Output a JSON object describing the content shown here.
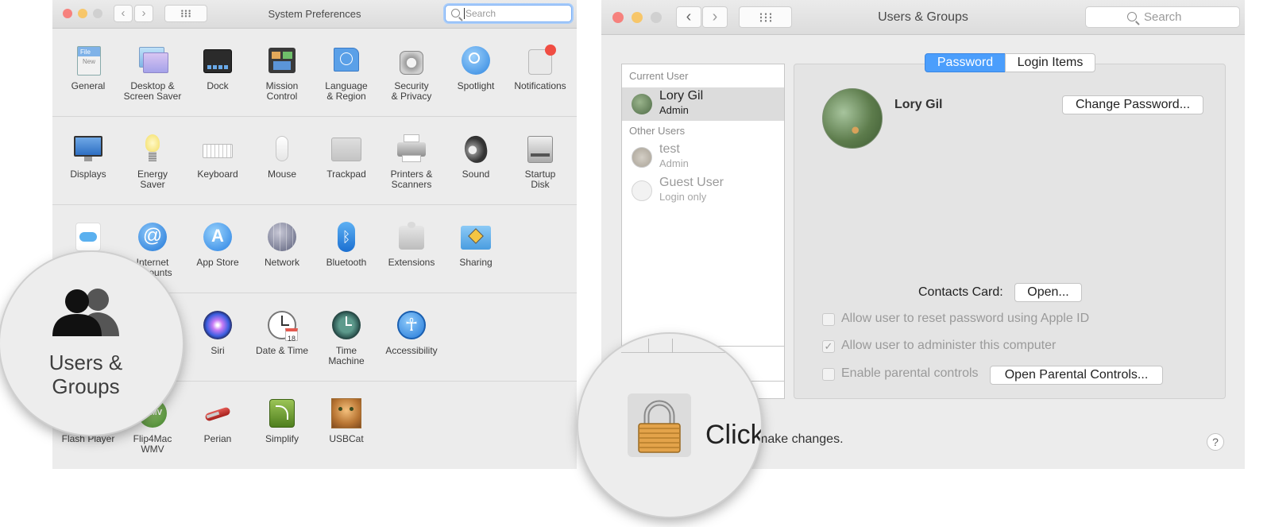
{
  "left_window": {
    "title": "System Preferences",
    "search_placeholder": "Search",
    "rows": [
      [
        {
          "label": "General",
          "icon": "general-icon"
        },
        {
          "label": "Desktop &\nScreen Saver",
          "icon": "desktop-screensaver-icon"
        },
        {
          "label": "Dock",
          "icon": "dock-icon"
        },
        {
          "label": "Mission\nControl",
          "icon": "mission-control-icon"
        },
        {
          "label": "Language\n& Region",
          "icon": "language-region-icon"
        },
        {
          "label": "Security\n& Privacy",
          "icon": "security-privacy-icon"
        },
        {
          "label": "Spotlight",
          "icon": "spotlight-icon"
        },
        {
          "label": "Notifications",
          "icon": "notifications-icon"
        }
      ],
      [
        {
          "label": "Displays",
          "icon": "displays-icon"
        },
        {
          "label": "Energy\nSaver",
          "icon": "energy-saver-icon"
        },
        {
          "label": "Keyboard",
          "icon": "keyboard-icon"
        },
        {
          "label": "Mouse",
          "icon": "mouse-icon"
        },
        {
          "label": "Trackpad",
          "icon": "trackpad-icon"
        },
        {
          "label": "Printers &\nScanners",
          "icon": "printers-scanners-icon"
        },
        {
          "label": "Sound",
          "icon": "sound-icon"
        },
        {
          "label": "Startup\nDisk",
          "icon": "startup-disk-icon"
        }
      ],
      [
        {
          "label": "",
          "icon": "icloud-icon"
        },
        {
          "label": "Internet\nAccounts",
          "icon": "internet-accounts-icon"
        },
        {
          "label": "App Store",
          "icon": "app-store-icon"
        },
        {
          "label": "Network",
          "icon": "network-icon"
        },
        {
          "label": "Bluetooth",
          "icon": "bluetooth-icon"
        },
        {
          "label": "Extensions",
          "icon": "extensions-icon"
        },
        {
          "label": "Sharing",
          "icon": "sharing-icon"
        }
      ],
      [
        {
          "label": "Siri",
          "icon": "siri-icon"
        },
        {
          "label": "Date & Time",
          "icon": "date-time-icon"
        },
        {
          "label": "Time\nMachine",
          "icon": "time-machine-icon"
        },
        {
          "label": "Accessibility",
          "icon": "accessibility-icon"
        }
      ],
      [
        {
          "label": "Flash Player",
          "icon": "flash-player-icon"
        },
        {
          "label": "Flip4Mac\nWMV",
          "icon": "flip4mac-icon"
        },
        {
          "label": "Perian",
          "icon": "perian-icon"
        },
        {
          "label": "Simplify",
          "icon": "simplify-icon"
        },
        {
          "label": "USBCat",
          "icon": "usbcat-icon"
        }
      ]
    ],
    "zoom_label": "Users &\nGroups"
  },
  "right_window": {
    "title": "Users & Groups",
    "search_placeholder": "Search",
    "list": {
      "current_header": "Current User",
      "other_header": "Other Users",
      "users": [
        {
          "name": "Lory  Gil",
          "role": "Admin"
        },
        {
          "name": "test",
          "role": "Admin"
        },
        {
          "name": "Guest User",
          "role": "Login only"
        }
      ]
    },
    "tabs": [
      "Password",
      "Login Items"
    ],
    "user_name": "Lory  Gil",
    "change_password": "Change Password...",
    "contacts_card_label": "Contacts Card:",
    "open_button": "Open...",
    "options": [
      {
        "label": "Allow user to reset password using Apple ID",
        "checked": false
      },
      {
        "label": "Allow user to administer this computer",
        "checked": true
      },
      {
        "label": "Enable parental controls",
        "checked": false
      }
    ],
    "open_parental_controls": "Open Parental Controls...",
    "lock_zoom_text": "Click",
    "lock_text": "make changes.",
    "help_label": "?"
  },
  "colors": {
    "accent": "#3b99fc",
    "traffic_red": "#fc605b",
    "traffic_yellow": "#fdbc40",
    "traffic_green": "#34c84a"
  }
}
